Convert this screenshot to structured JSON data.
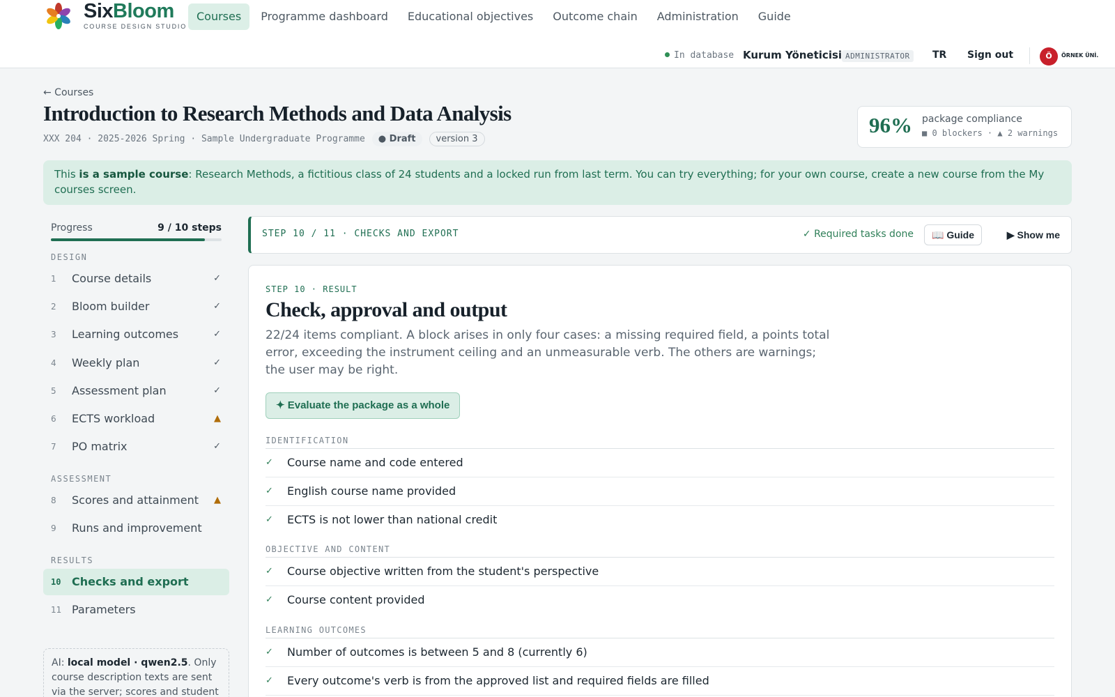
{
  "header": {
    "brand_six": "Six",
    "brand_bloom": "Bloom",
    "brand_sub": "COURSE DESIGN STUDIO",
    "nav": [
      "Courses",
      "Programme dashboard",
      "Educational objectives",
      "Outcome chain",
      "Administration",
      "Guide"
    ],
    "active_nav": "Courses",
    "db_status": "In database",
    "user_name": "Kurum Yöneticisi",
    "user_role": "ADMINISTRATOR",
    "lang": "TR",
    "signout": "Sign out",
    "uni_initial": "Ö",
    "uni_name": "ÖRNEK ÜNİ.",
    "colors": {
      "accent": "#1f6e52",
      "brand_dark": "#1c2730"
    }
  },
  "course": {
    "back": "← Courses",
    "title": "Introduction to Research Methods and Data Analysis",
    "meta": "XXX 204 · 2025-2026 Spring · Sample Undergraduate Programme",
    "status": "● Draft",
    "version": "version 3"
  },
  "compliance": {
    "percent": "96%",
    "label": "package compliance",
    "stats": "■ 0 blockers · ▲ 2 warnings"
  },
  "banner": {
    "pre": "This ",
    "bold": "is a sample course",
    "post": ": Research Methods, a fictitious class of 24 students and a locked run from last term. You can try everything; for your own course, create a new course from the My courses screen."
  },
  "sidebar": {
    "progress_label": "Progress",
    "progress_count": "9 / 10 steps",
    "progress_fraction": 0.9,
    "groups": {
      "design": "DESIGN",
      "assessment": "ASSESSMENT",
      "results": "RESULTS"
    },
    "steps": [
      {
        "num": "1",
        "label": "Course details",
        "status": "✓",
        "kind": "ok"
      },
      {
        "num": "2",
        "label": "Bloom builder",
        "status": "✓",
        "kind": "ok"
      },
      {
        "num": "3",
        "label": "Learning outcomes",
        "status": "✓",
        "kind": "ok"
      },
      {
        "num": "4",
        "label": "Weekly plan",
        "status": "✓",
        "kind": "ok"
      },
      {
        "num": "5",
        "label": "Assessment plan",
        "status": "✓",
        "kind": "ok"
      },
      {
        "num": "6",
        "label": "ECTS workload",
        "status": "▲",
        "kind": "warn"
      },
      {
        "num": "7",
        "label": "PO matrix",
        "status": "✓",
        "kind": "ok"
      },
      {
        "num": "8",
        "label": "Scores and attainment",
        "status": "▲",
        "kind": "warn"
      },
      {
        "num": "9",
        "label": "Runs and improvement",
        "status": "",
        "kind": "none"
      },
      {
        "num": "10",
        "label": "Checks and export",
        "status": "",
        "kind": "active"
      },
      {
        "num": "11",
        "label": "Parameters",
        "status": "",
        "kind": "none"
      }
    ],
    "ai": {
      "pre": "AI: ",
      "bold": "local model · qwen2.5",
      "post": ". Only course description texts are sent via the server; scores and student"
    }
  },
  "stephead": {
    "label": "STEP 10 / 11 · CHECKS AND EXPORT",
    "tasks_done": "✓ Required tasks done",
    "guide": "📖 Guide",
    "show_me": "▶ Show me"
  },
  "main": {
    "eyebrow": "STEP 10 · RESULT",
    "title": "Check, approval and output",
    "description": "22/24 items compliant. A block arises in only four cases: a missing required field, a points total error, exceeding the instrument ceiling and an unmeasurable verb. The others are warnings; the user may be right.",
    "evaluate": "✦ Evaluate the package as a whole",
    "sections": [
      {
        "label": "IDENTIFICATION",
        "items": [
          "Course name and code entered",
          "English course name provided",
          "ECTS is not lower than national credit"
        ]
      },
      {
        "label": "OBJECTIVE AND CONTENT",
        "items": [
          "Course objective written from the student's perspective",
          "Course content provided"
        ]
      },
      {
        "label": "LEARNING OUTCOMES",
        "items": [
          "Number of outcomes is between 5 and 8 (currently 6)",
          "Every outcome's verb is from the approved list and required fields are filled"
        ]
      }
    ],
    "tick": "✓"
  }
}
